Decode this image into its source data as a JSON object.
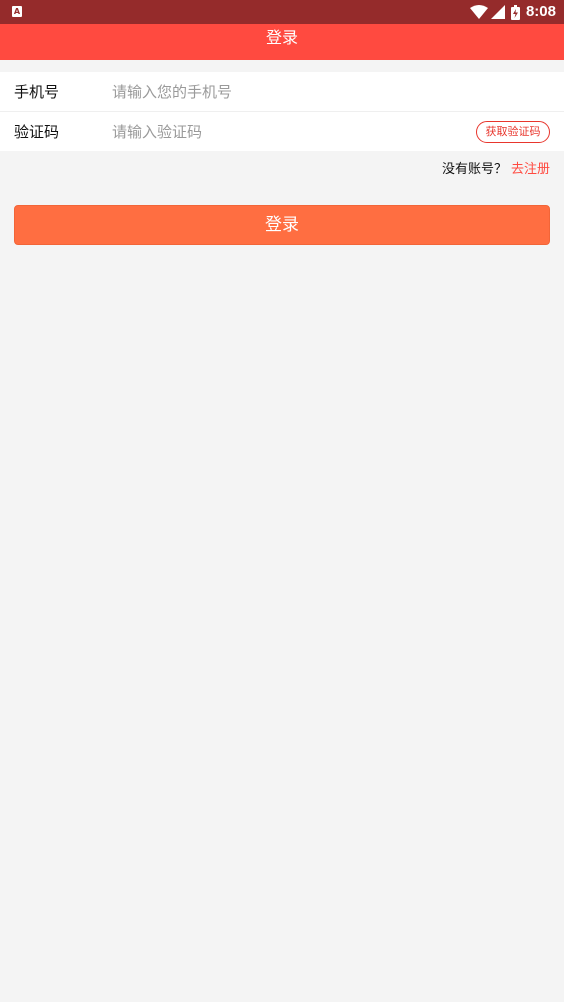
{
  "status_bar": {
    "left_icon_label": "A",
    "time": "8:08",
    "icons": [
      "wifi-icon",
      "cell-signal-icon",
      "battery-charging-icon"
    ]
  },
  "app_bar": {
    "title": "登录"
  },
  "form": {
    "phone": {
      "label": "手机号",
      "placeholder": "请输入您的手机号",
      "value": ""
    },
    "code": {
      "label": "验证码",
      "placeholder": "请输入验证码",
      "value": "",
      "get_code_label": "获取验证码"
    }
  },
  "register": {
    "prompt": "没有账号？",
    "link_label": "去注册"
  },
  "login_button_label": "登录",
  "colors": {
    "status_bar": "#952b2b",
    "app_bar": "#ff4a40",
    "accent": "#e8362d",
    "login_button": "#ff6e41",
    "background": "#f4f4f4"
  }
}
